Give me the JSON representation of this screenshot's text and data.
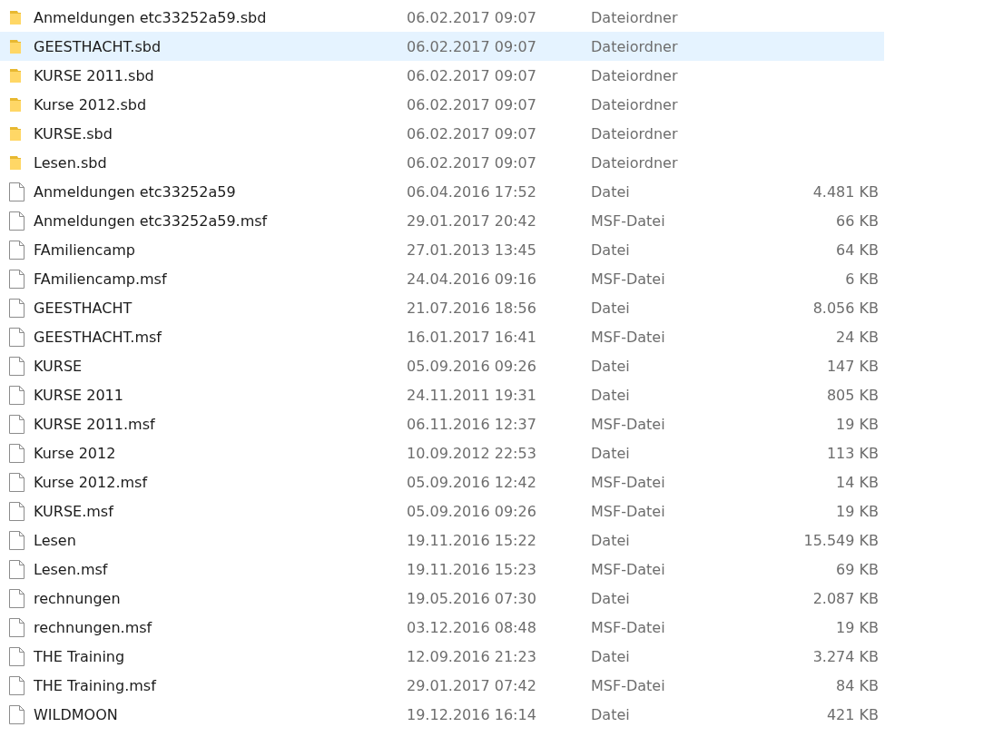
{
  "files": [
    {
      "kind": "folder",
      "name": "Anmeldungen etc33252a59.sbd",
      "date": "06.02.2017 09:07",
      "type": "Dateiordner",
      "selected": false
    },
    {
      "kind": "folder",
      "name": "GEESTHACHT.sbd",
      "date": "06.02.2017 09:07",
      "type": "Dateiordner",
      "selected": true
    },
    {
      "kind": "folder",
      "name": "KURSE 2011.sbd",
      "date": "06.02.2017 09:07",
      "type": "Dateiordner",
      "selected": false
    },
    {
      "kind": "folder",
      "name": "Kurse 2012.sbd",
      "date": "06.02.2017 09:07",
      "type": "Dateiordner",
      "selected": false
    },
    {
      "kind": "folder",
      "name": "KURSE.sbd",
      "date": "06.02.2017 09:07",
      "type": "Dateiordner",
      "selected": false
    },
    {
      "kind": "folder",
      "name": "Lesen.sbd",
      "date": "06.02.2017 09:07",
      "type": "Dateiordner",
      "selected": false
    },
    {
      "kind": "file",
      "name": "Anmeldungen etc33252a59",
      "date": "06.04.2016 17:52",
      "type": "Datei",
      "size": "4.481 KB",
      "selected": false
    },
    {
      "kind": "file",
      "name": "Anmeldungen etc33252a59.msf",
      "date": "29.01.2017 20:42",
      "type": "MSF-Datei",
      "size": "66 KB",
      "selected": false
    },
    {
      "kind": "file",
      "name": "FAmiliencamp",
      "date": "27.01.2013 13:45",
      "type": "Datei",
      "size": "64 KB",
      "selected": false
    },
    {
      "kind": "file",
      "name": "FAmiliencamp.msf",
      "date": "24.04.2016 09:16",
      "type": "MSF-Datei",
      "size": "6 KB",
      "selected": false
    },
    {
      "kind": "file",
      "name": "GEESTHACHT",
      "date": "21.07.2016 18:56",
      "type": "Datei",
      "size": "8.056 KB",
      "selected": false
    },
    {
      "kind": "file",
      "name": "GEESTHACHT.msf",
      "date": "16.01.2017 16:41",
      "type": "MSF-Datei",
      "size": "24 KB",
      "selected": false
    },
    {
      "kind": "file",
      "name": "KURSE",
      "date": "05.09.2016 09:26",
      "type": "Datei",
      "size": "147 KB",
      "selected": false
    },
    {
      "kind": "file",
      "name": "KURSE 2011",
      "date": "24.11.2011 19:31",
      "type": "Datei",
      "size": "805 KB",
      "selected": false
    },
    {
      "kind": "file",
      "name": "KURSE 2011.msf",
      "date": "06.11.2016 12:37",
      "type": "MSF-Datei",
      "size": "19 KB",
      "selected": false
    },
    {
      "kind": "file",
      "name": "Kurse 2012",
      "date": "10.09.2012 22:53",
      "type": "Datei",
      "size": "113 KB",
      "selected": false
    },
    {
      "kind": "file",
      "name": "Kurse 2012.msf",
      "date": "05.09.2016 12:42",
      "type": "MSF-Datei",
      "size": "14 KB",
      "selected": false
    },
    {
      "kind": "file",
      "name": "KURSE.msf",
      "date": "05.09.2016 09:26",
      "type": "MSF-Datei",
      "size": "19 KB",
      "selected": false
    },
    {
      "kind": "file",
      "name": "Lesen",
      "date": "19.11.2016 15:22",
      "type": "Datei",
      "size": "15.549 KB",
      "selected": false
    },
    {
      "kind": "file",
      "name": "Lesen.msf",
      "date": "19.11.2016 15:23",
      "type": "MSF-Datei",
      "size": "69 KB",
      "selected": false
    },
    {
      "kind": "file",
      "name": "rechnungen",
      "date": "19.05.2016 07:30",
      "type": "Datei",
      "size": "2.087 KB",
      "selected": false
    },
    {
      "kind": "file",
      "name": "rechnungen.msf",
      "date": "03.12.2016 08:48",
      "type": "MSF-Datei",
      "size": "19 KB",
      "selected": false
    },
    {
      "kind": "file",
      "name": "THE Training",
      "date": "12.09.2016 21:23",
      "type": "Datei",
      "size": "3.274 KB",
      "selected": false
    },
    {
      "kind": "file",
      "name": "THE Training.msf",
      "date": "29.01.2017 07:42",
      "type": "MSF-Datei",
      "size": "84 KB",
      "selected": false
    },
    {
      "kind": "file",
      "name": "WILDMOON",
      "date": "19.12.2016 16:14",
      "type": "Datei",
      "size": "421 KB",
      "selected": false
    }
  ]
}
